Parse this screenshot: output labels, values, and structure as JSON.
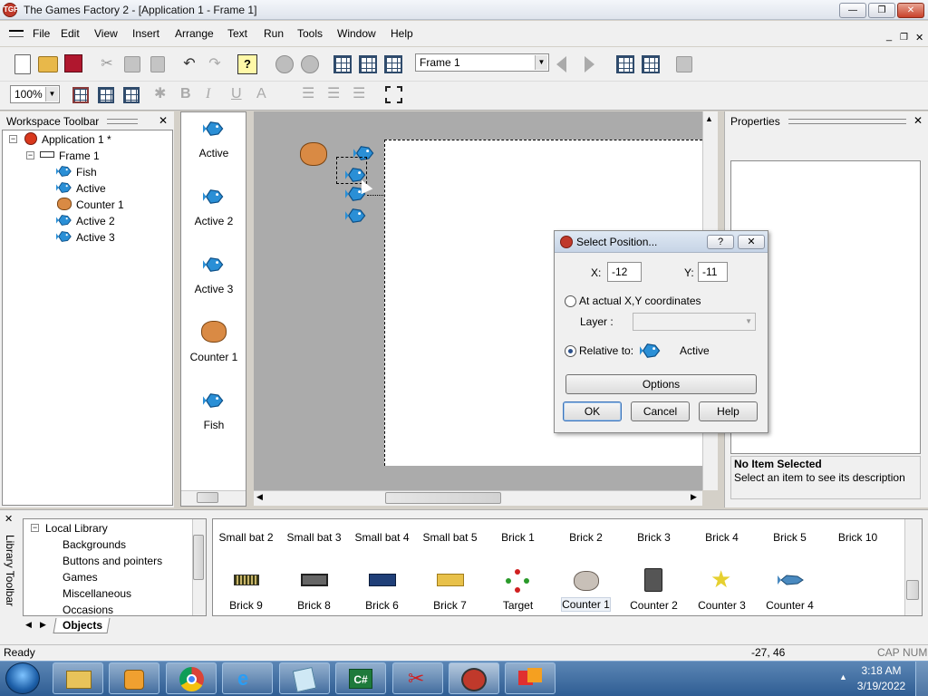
{
  "window": {
    "title": "The Games Factory 2 - [Application 1 - Frame 1]",
    "app_icon": "TGF"
  },
  "menu": [
    "File",
    "Edit",
    "View",
    "Insert",
    "Arrange",
    "Text",
    "Run",
    "Tools",
    "Window",
    "Help"
  ],
  "toolbar": {
    "frame_select": "Frame 1",
    "zoom": "100%"
  },
  "workspace": {
    "title": "Workspace Toolbar",
    "app_node": "Application 1 *",
    "frame_node": "Frame 1",
    "items": [
      "Fish",
      "Active",
      "Counter 1",
      "Active 2",
      "Active 3"
    ]
  },
  "object_list": [
    "Active",
    "Active 2",
    "Active 3",
    "Counter 1",
    "Fish"
  ],
  "properties": {
    "title": "Properties",
    "status_title": "No Item Selected",
    "status_desc": "Select an item to see its description"
  },
  "dialog": {
    "title": "Select Position...",
    "x_label": "X:",
    "x_value": "-12",
    "y_label": "Y:",
    "y_value": "-11",
    "opt_actual": "At actual X,Y coordinates",
    "layer_label": "Layer :",
    "layer_value": "",
    "opt_relative": "Relative to:",
    "relative_object": "Active",
    "options_btn": "Options",
    "ok_btn": "OK",
    "cancel_btn": "Cancel",
    "help_btn": "Help"
  },
  "library": {
    "side_label": "Library Toolbar",
    "tree_root": "Local Library",
    "tree_items": [
      "Backgrounds",
      "Buttons and pointers",
      "Games",
      "Miscellaneous",
      "Occasions"
    ],
    "tab": "Objects",
    "row1": [
      "Small bat 2",
      "Small bat 3",
      "Small bat 4",
      "Small bat 5",
      "Brick 1",
      "Brick 2",
      "Brick 3",
      "Brick 4",
      "Brick 5",
      "Brick 10"
    ],
    "row2": [
      "Brick 9",
      "Brick 8",
      "Brick 6",
      "Brick 7",
      "Target",
      "Counter 1",
      "Counter 2",
      "Counter 3",
      "Counter 4"
    ]
  },
  "status": {
    "ready": "Ready",
    "coords": "-27, 46",
    "cap": "CAP",
    "num": "NUM"
  },
  "taskbar": {
    "time": "3:18 AM",
    "date": "3/19/2022"
  },
  "colors": {
    "accent": "#2f5d93",
    "canvas_bg": "#ababab",
    "fish_blue": "#2a8fd6"
  }
}
